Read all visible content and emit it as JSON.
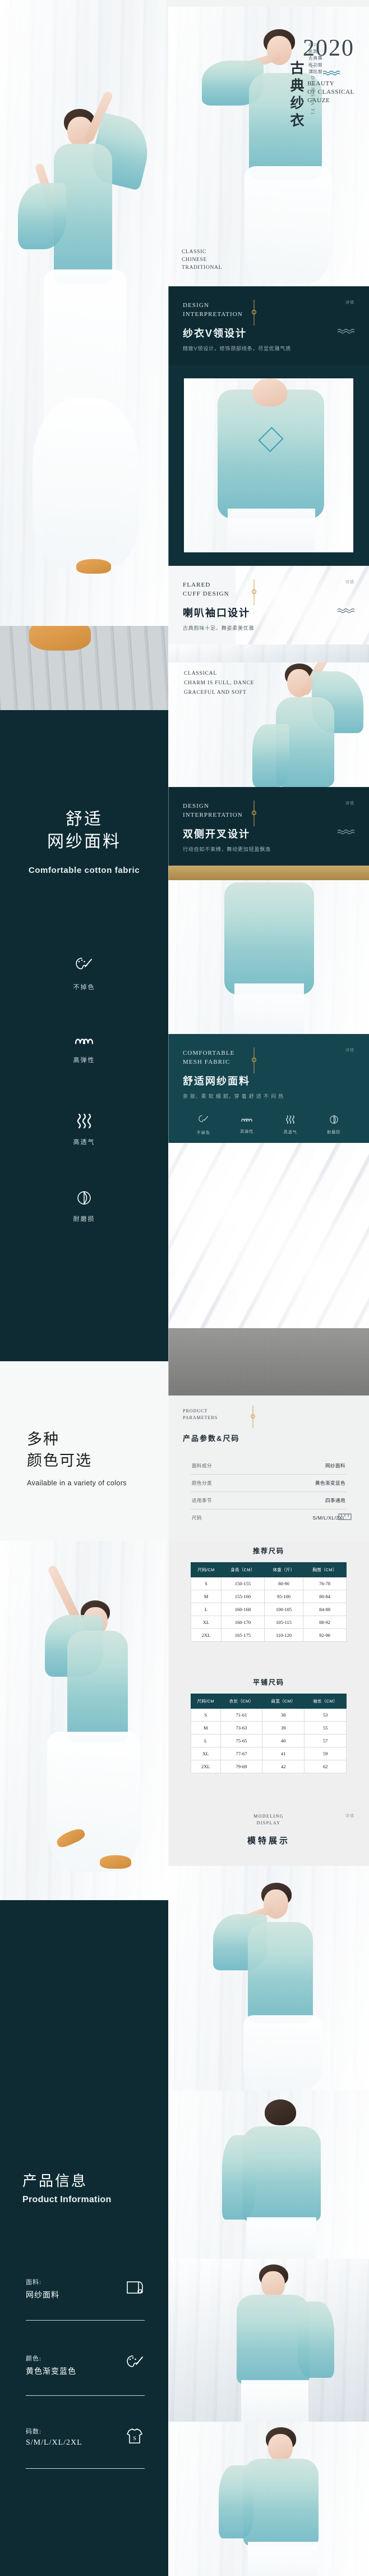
{
  "hero": {
    "year": "2020",
    "eyebrow_en": "BEAUTY\nOF CLASSICAL\nGAUZE",
    "title_cn": "古典纱衣",
    "title_pinyin": "GU DIAN SHA YI",
    "side_note": "2020\n新款\n古典舞\n练功服\n演出服",
    "footer_en": "CLASSIC\nCHINESE\nTRADITIONAL"
  },
  "banners": [
    {
      "id": "v-neck",
      "en": "DESIGN\nINTERPRETATION",
      "cn": "纱衣V领设计",
      "note": "精致V领设计，修饰颈部线条，尽显优雅气质",
      "mini": "详情",
      "theme": "dark"
    },
    {
      "id": "flared-cuff",
      "en": "FLARED\nCUFF DESIGN",
      "cn": "喇叭袖口设计",
      "note": "古典韵味十足，舞姿柔美优雅",
      "mini": "详情",
      "theme": "light"
    },
    {
      "id": "cross-tie",
      "en": "DESIGN\nINTERPRETATION",
      "cn": "双侧开叉设计",
      "note": "行动自如不束缚，舞动更加轻盈飘逸",
      "mini": "详情",
      "theme": "dark"
    }
  ],
  "classical_caption": "CLASSICAL\nCHARM IS FULL, DANCE\nGRACEFUL AND SOFT",
  "fabric_section": {
    "title_cn_line1": "舒适",
    "title_cn_line2": "网纱面料",
    "title_en": "Comfortable cotton fabric",
    "features": [
      {
        "icon": "palette-icon",
        "label": "不掉色"
      },
      {
        "icon": "elastic-icon",
        "label": "高弹性"
      },
      {
        "icon": "breathable-icon",
        "label": "高透气"
      },
      {
        "icon": "abrasion-icon",
        "label": "耐磨损"
      }
    ]
  },
  "fabric_banner": {
    "en": "COMFORTABLE\nMESH FABRIC",
    "cn": "舒适网纱面料",
    "note": "亲 肤、柔 软 细 腻，穿 着 舒 适 不 闷 热",
    "mini": "详情",
    "chips": [
      "不掉色",
      "高弹性",
      "高透气",
      "耐磨损"
    ]
  },
  "color_section": {
    "cn_line1": "多种",
    "cn_line2": "颜色可选",
    "en": "Available in a variety of colors"
  },
  "param_card": {
    "head_en": "PRODUCT\nPARAMETERS",
    "head_cn": "产品参数&尺码",
    "rows": [
      {
        "k": "面料成分",
        "v": "网纱面料"
      },
      {
        "k": "颜色分类",
        "v": "黄色渐变蓝色"
      },
      {
        "k": "适用季节",
        "v": "四季通用"
      },
      {
        "k": "尺码",
        "v": "S/M/L/XL/2XL"
      }
    ]
  },
  "size_tables": [
    {
      "title": "推荐尺码",
      "headers": [
        "尺码/CM",
        "身高（CM）",
        "体重（斤）",
        "胸围（CM）"
      ],
      "rows": [
        [
          "S",
          "150-155",
          "80-90",
          "76-78"
        ],
        [
          "M",
          "155-160",
          "95-100",
          "80-84"
        ],
        [
          "L",
          "160-168",
          "100-105",
          "84-88"
        ],
        [
          "XL",
          "160-170",
          "105-115",
          "88-92"
        ],
        [
          "2XL",
          "165-175",
          "110-120",
          "92-96"
        ]
      ]
    },
    {
      "title": "平铺尺码",
      "headers": [
        "尺码/CM",
        "衣长（CM）",
        "肩宽（CM）",
        "袖长（CM）"
      ],
      "rows": [
        [
          "S",
          "71-61",
          "38",
          "53"
        ],
        [
          "M",
          "73-63",
          "39",
          "55"
        ],
        [
          "L",
          "75-65",
          "40",
          "57"
        ],
        [
          "XL",
          "77-67",
          "41",
          "59"
        ],
        [
          "2XL",
          "79-69",
          "42",
          "62"
        ]
      ]
    }
  ],
  "model_show": {
    "en": "MODELING\nDISPLAY",
    "cn": "模特展示",
    "mini": "详情"
  },
  "product_information": {
    "title_cn": "产品信息",
    "title_en": "Product Information",
    "rows": [
      {
        "key": "面料:",
        "value": "网纱面料",
        "icon": "fabric-roll-icon"
      },
      {
        "key": "颜色:",
        "value": "黄色渐变蓝色",
        "icon": "palette-icon"
      },
      {
        "key": "码数:",
        "value": "S/M/L/XL/2XL",
        "icon": "tshirt-size-icon"
      }
    ]
  },
  "colors": {
    "deep_navy": "#0e2b33",
    "teal": "#15454f",
    "accent_gold": "#c9a24a",
    "dress_blue": "#8fc9cd",
    "paper": "#f2f3f3"
  }
}
